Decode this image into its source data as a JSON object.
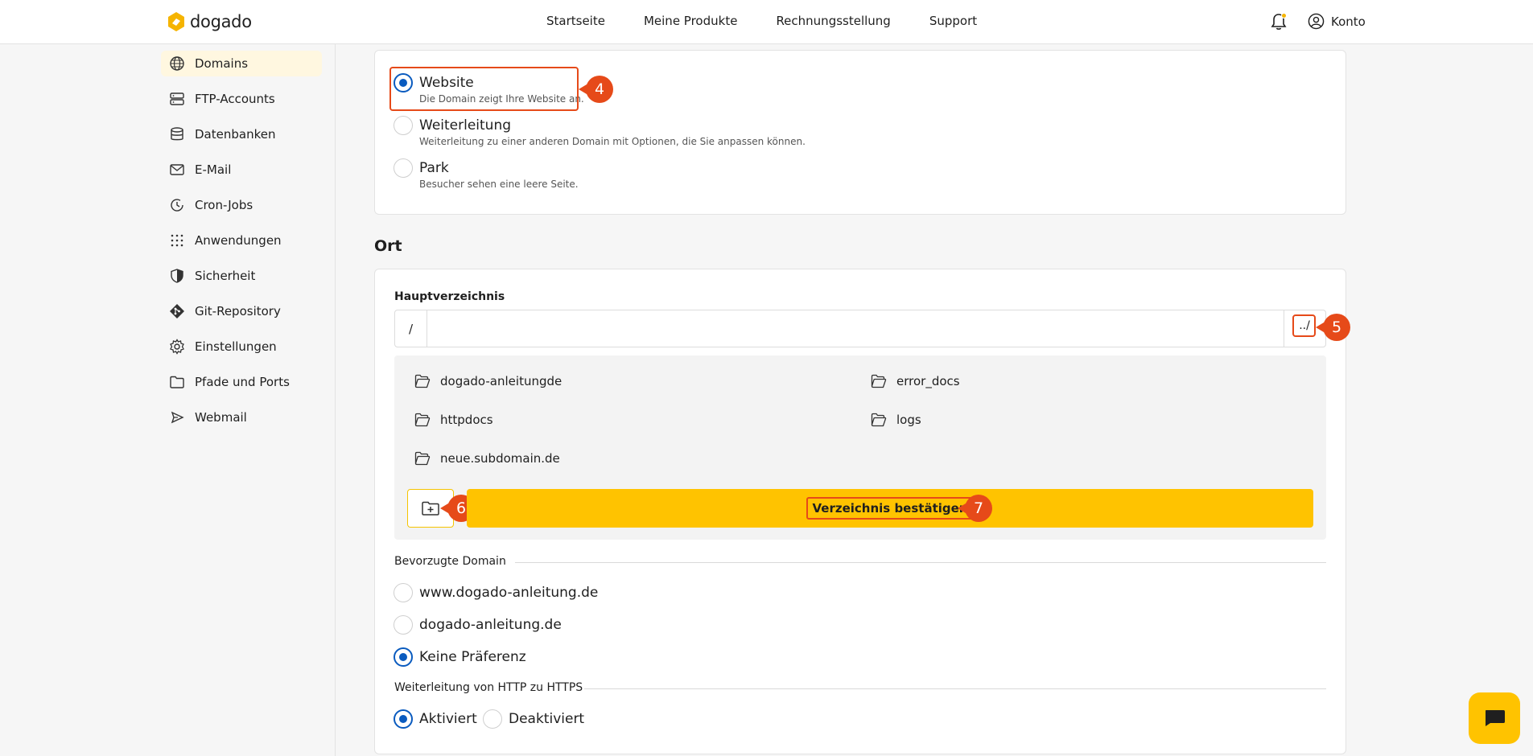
{
  "header": {
    "brand": "dogado",
    "nav": [
      "Startseite",
      "Meine Produkte",
      "Rechnungsstellung",
      "Support"
    ],
    "account_label": "Konto",
    "brand_color": "#f5b400"
  },
  "sidebar": {
    "items": [
      {
        "label": "Domains",
        "icon": "globe-icon",
        "active": true
      },
      {
        "label": "FTP-Accounts",
        "icon": "server-icon"
      },
      {
        "label": "Datenbanken",
        "icon": "database-icon"
      },
      {
        "label": "E-Mail",
        "icon": "mail-icon"
      },
      {
        "label": "Cron-Jobs",
        "icon": "clock-icon"
      },
      {
        "label": "Anwendungen",
        "icon": "grid-icon"
      },
      {
        "label": "Sicherheit",
        "icon": "shield-icon"
      },
      {
        "label": "Git-Repository",
        "icon": "git-icon"
      },
      {
        "label": "Einstellungen",
        "icon": "gear-icon"
      },
      {
        "label": "Pfade und Ports",
        "icon": "folder-icon"
      },
      {
        "label": "Webmail",
        "icon": "send-icon"
      }
    ]
  },
  "hosting_type": {
    "options": [
      {
        "title": "Website",
        "desc": "Die Domain zeigt Ihre Website an.",
        "selected": true
      },
      {
        "title": "Weiterleitung",
        "desc": "Weiterleitung zu einer anderen Domain mit Optionen, die Sie anpassen können.",
        "selected": false
      },
      {
        "title": "Park",
        "desc": "Besucher sehen eine leere Seite.",
        "selected": false
      }
    ]
  },
  "location": {
    "section_title": "Ort",
    "root_label": "Hauptverzeichnis",
    "path_prefix": "/",
    "path_value": "",
    "browse_label": "../",
    "directories": [
      "dogado-anleitungde",
      "error_docs",
      "httpdocs",
      "logs",
      "neue.subdomain.de"
    ],
    "confirm_label": "Verzeichnis bestätigen",
    "preferred_domain_label": "Bevorzugte Domain",
    "preferred_domain_options": [
      {
        "label": "www.dogado-anleitung.de",
        "selected": false
      },
      {
        "label": "dogado-anleitung.de",
        "selected": false
      },
      {
        "label": "Keine Präferenz",
        "selected": true
      }
    ],
    "https_redirect_label": "Weiterleitung von HTTP zu HTTPS",
    "https_redirect_options": [
      {
        "label": "Aktiviert",
        "selected": true
      },
      {
        "label": "Deaktiviert",
        "selected": false
      }
    ]
  },
  "annotations": [
    "4",
    "5",
    "6",
    "7"
  ]
}
